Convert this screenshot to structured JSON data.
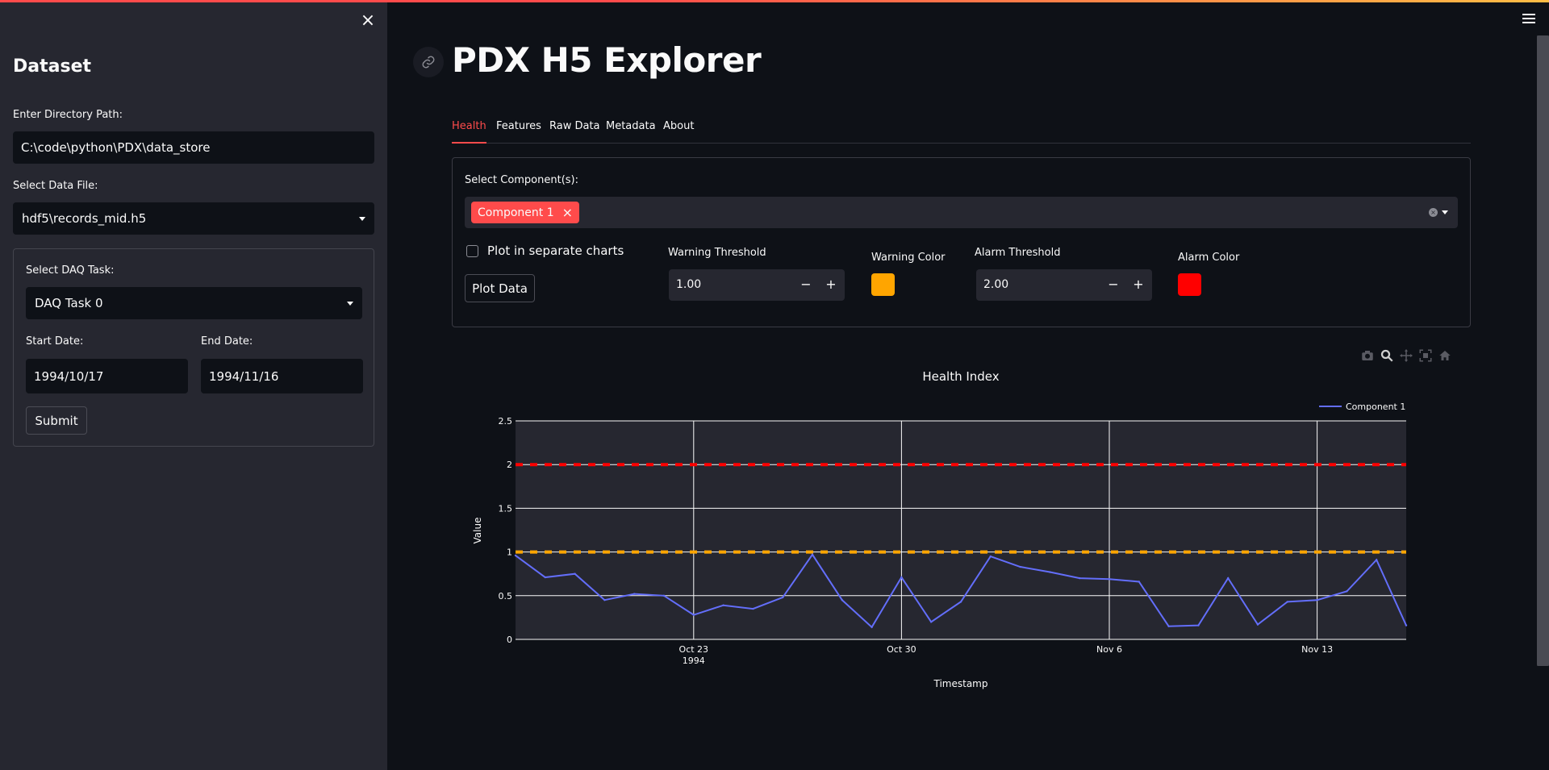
{
  "sidebar": {
    "title": "Dataset",
    "directory_label": "Enter Directory Path:",
    "directory_value": "C:\\code\\python\\PDX\\data_store",
    "file_label": "Select Data File:",
    "file_value": "hdf5\\records_mid.h5",
    "daq_label": "Select DAQ Task:",
    "daq_value": "DAQ Task 0",
    "start_label": "Start Date:",
    "start_value": "1994/10/17",
    "end_label": "End Date:",
    "end_value": "1994/11/16",
    "submit_label": "Submit",
    "close_icon": "×"
  },
  "header": {
    "title": "PDX H5 Explorer"
  },
  "tabs": [
    {
      "label": "Health",
      "active": true
    },
    {
      "label": "Features",
      "active": false
    },
    {
      "label": "Raw Data",
      "active": false
    },
    {
      "label": "Metadata",
      "active": false
    },
    {
      "label": "About",
      "active": false
    }
  ],
  "controls": {
    "component_label": "Select Component(s):",
    "selected_component": "Component 1",
    "chip_remove": "×",
    "clear_icon": "×",
    "separate_label": "Plot in separate charts",
    "separate_checked": false,
    "plot_button": "Plot Data",
    "warning_threshold_label": "Warning Threshold",
    "warning_threshold_value": "1.00",
    "warning_color_label": "Warning Color",
    "warning_color": "#ffa500",
    "alarm_threshold_label": "Alarm Threshold",
    "alarm_threshold_value": "2.00",
    "alarm_color_label": "Alarm Color",
    "alarm_color": "#ff0000",
    "minus": "−",
    "plus": "+"
  },
  "colors": {
    "accent": "#ff4b4b",
    "background": "#0e1117",
    "sidebar": "#262730",
    "series": "#636efa"
  },
  "modebar_icons": [
    "camera-icon",
    "zoom-icon",
    "pan-icon",
    "autoscale-icon",
    "home-icon"
  ],
  "chart_data": {
    "type": "line",
    "title": "Health Index",
    "xlabel": "Timestamp",
    "ylabel": "Value",
    "ylim": [
      0,
      2.5
    ],
    "yticks": [
      "0",
      "0.5",
      "1",
      "1.5",
      "2",
      "2.5"
    ],
    "xlim": [
      "1994-10-17",
      "1994-11-16"
    ],
    "xticks": [
      {
        "date": "1994-10-23",
        "label": "Oct 23",
        "sublabel": "1994"
      },
      {
        "date": "1994-10-30",
        "label": "Oct 30",
        "sublabel": ""
      },
      {
        "date": "1994-11-06",
        "label": "Nov 6",
        "sublabel": ""
      },
      {
        "date": "1994-11-13",
        "label": "Nov 13",
        "sublabel": ""
      }
    ],
    "legend": "top-right",
    "grid": true,
    "series": [
      {
        "name": "Component 1",
        "x": [
          "1994-10-17",
          "1994-10-18",
          "1994-10-19",
          "1994-10-20",
          "1994-10-21",
          "1994-10-22",
          "1994-10-23",
          "1994-10-24",
          "1994-10-25",
          "1994-10-26",
          "1994-10-27",
          "1994-10-28",
          "1994-10-29",
          "1994-10-30",
          "1994-10-31",
          "1994-11-01",
          "1994-11-02",
          "1994-11-03",
          "1994-11-04",
          "1994-11-05",
          "1994-11-06",
          "1994-11-07",
          "1994-11-08",
          "1994-11-09",
          "1994-11-10",
          "1994-11-11",
          "1994-11-12",
          "1994-11-13",
          "1994-11-14",
          "1994-11-15",
          "1994-11-16"
        ],
        "values": [
          0.96,
          0.71,
          0.75,
          0.45,
          0.52,
          0.5,
          0.28,
          0.39,
          0.35,
          0.48,
          0.97,
          0.45,
          0.14,
          0.71,
          0.2,
          0.43,
          0.95,
          0.83,
          0.77,
          0.7,
          0.69,
          0.66,
          0.15,
          0.16,
          0.7,
          0.17,
          0.43,
          0.45,
          0.55,
          0.91,
          0.16
        ]
      }
    ],
    "thresholds": [
      {
        "name": "Warning",
        "value": 1.0,
        "color": "#ffa500"
      },
      {
        "name": "Alarm",
        "value": 2.0,
        "color": "#ff0000"
      }
    ]
  }
}
